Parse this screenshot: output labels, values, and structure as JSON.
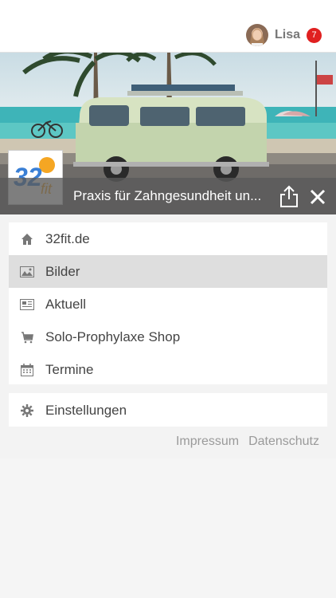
{
  "header": {
    "user_name": "Lisa",
    "notification_count": "7"
  },
  "hero": {
    "title": "Praxis für Zahngesundheit un..."
  },
  "logo": {
    "text": "32fit"
  },
  "menu": [
    {
      "label": "32fit.de",
      "icon": "home-icon"
    },
    {
      "label": "Bilder",
      "icon": "image-icon",
      "active": true
    },
    {
      "label": "Aktuell",
      "icon": "newspaper-icon"
    },
    {
      "label": "Solo-Prophylaxe Shop",
      "icon": "cart-icon"
    },
    {
      "label": "Termine",
      "icon": "calendar-icon"
    }
  ],
  "settings": {
    "label": "Einstellungen",
    "icon": "gear-icon"
  },
  "footer": {
    "impressum": "Impressum",
    "datenschutz": "Datenschutz"
  },
  "colors": {
    "badge": "#e02020",
    "active_row": "#dedede",
    "logo_orange": "#f5a623",
    "logo_blue": "#3a7fd5"
  }
}
